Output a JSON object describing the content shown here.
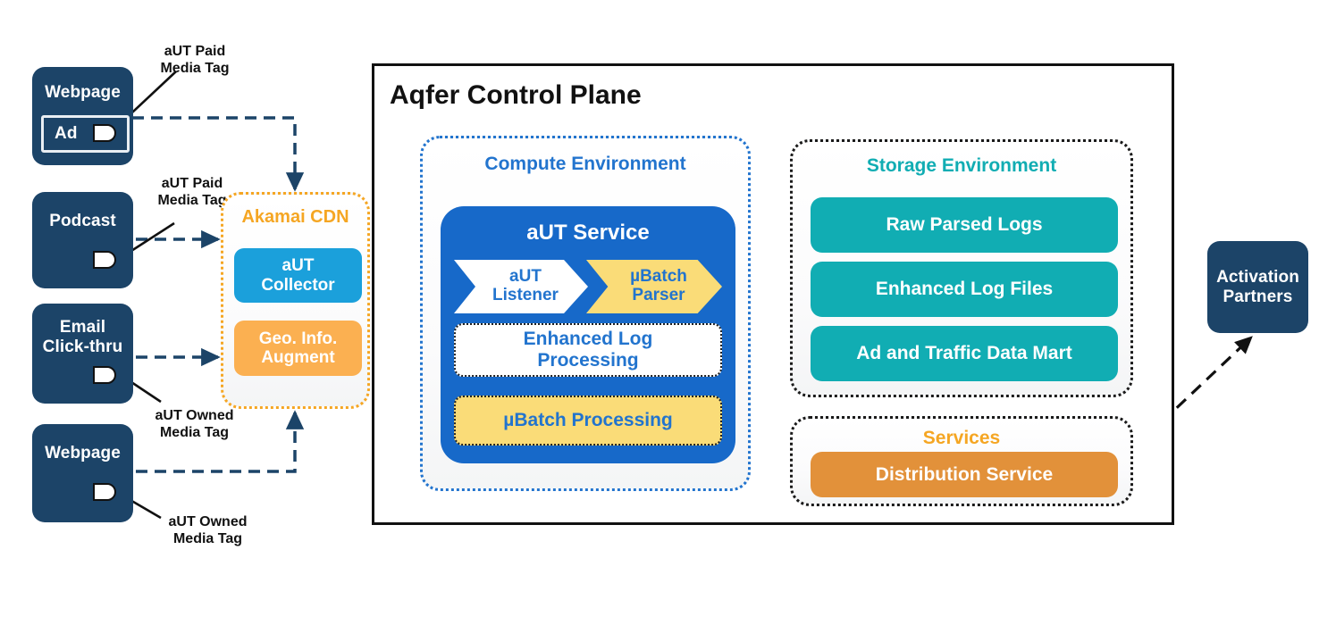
{
  "diagram": {
    "control_plane_title": "Aqfer Control Plane"
  },
  "sources": [
    {
      "name": "webpage-ad",
      "label": "Webpage",
      "sub_label": "Ad",
      "tag_icon": "media-tag-icon"
    },
    {
      "name": "podcast",
      "label": "Podcast",
      "tag_icon": "media-tag-icon"
    },
    {
      "name": "email-click-thru",
      "label": "Email\nClick-thru",
      "tag_icon": "media-tag-icon"
    },
    {
      "name": "webpage",
      "label": "Webpage",
      "tag_icon": "media-tag-icon"
    }
  ],
  "edge_labels": [
    {
      "name": "aut-paid-media-tag-1",
      "text": "aUT Paid\nMedia Tag"
    },
    {
      "name": "aut-paid-media-tag-2",
      "text": "aUT Paid\nMedia Tag"
    },
    {
      "name": "aut-owned-media-tag-1",
      "text": "aUT Owned\nMedia Tag"
    },
    {
      "name": "aut-owned-media-tag-2",
      "text": "aUT Owned\nMedia Tag"
    }
  ],
  "akamai": {
    "title": "Akamai CDN",
    "items": [
      {
        "name": "aut-collector",
        "label": "aUT\nCollector"
      },
      {
        "name": "geo-info-augment",
        "label": "Geo. Info.\nAugment"
      }
    ]
  },
  "compute": {
    "title": "Compute Environment",
    "service_title": "aUT Service",
    "chevrons": [
      {
        "name": "aut-listener",
        "label": "aUT\nListener"
      },
      {
        "name": "ubatch-parser",
        "label": "µBatch\nParser"
      }
    ],
    "boxes": [
      {
        "name": "enhanced-log-processing",
        "label": "Enhanced Log\nProcessing"
      },
      {
        "name": "ubatch-processing",
        "label": "µBatch Processing"
      }
    ]
  },
  "storage": {
    "title": "Storage Environment",
    "items": [
      {
        "name": "raw-parsed-logs",
        "label": "Raw Parsed Logs"
      },
      {
        "name": "enhanced-log-files",
        "label": "Enhanced Log Files"
      },
      {
        "name": "ad-and-traffic-data-mart",
        "label": "Ad and Traffic Data Mart"
      }
    ]
  },
  "services": {
    "title": "Services",
    "items": [
      {
        "name": "distribution-service",
        "label": "Distribution Service"
      }
    ]
  },
  "activation": {
    "label": "Activation\nPartners"
  },
  "colors": {
    "navy": "#1C4468",
    "blue": "#1769C9",
    "light_blue": "#1BA0DB",
    "teal": "#11ADB3",
    "yellow": "#FADC78",
    "orange": "#E2913A",
    "light_orange": "#FBB051",
    "amber_text": "#F5A623",
    "compute_blue_text": "#2274CE",
    "dash_navy": "#1C4468"
  }
}
